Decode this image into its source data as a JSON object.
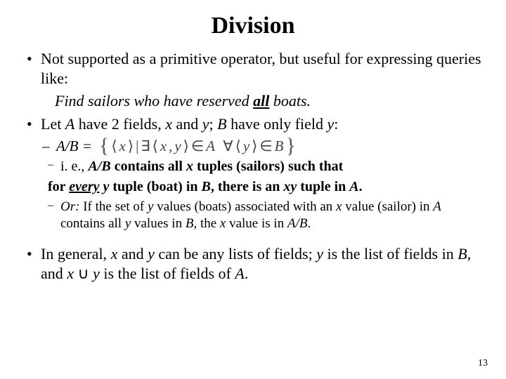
{
  "title": "Division",
  "bullets": {
    "b1a": "Not supported as a primitive operator, but useful for expressing queries like:",
    "example_pre": "Find sailors who have reserved ",
    "example_all": "all",
    "example_post": " boats.",
    "b2_pre": "Let ",
    "b2_A": "A",
    "b2_mid1": " have 2 fields, ",
    "b2_x": "x",
    "b2_and": " and ",
    "b2_y": "y",
    "b2_mid2": "; ",
    "b2_B": "B",
    "b2_mid3": " have only field ",
    "b2_y2": "y",
    "b2_end": ":",
    "sub1_lhs": "A/B =",
    "subsub1_pre": "i. e., ",
    "subsub1_ab": "A/B",
    "subsub1_mid1": " contains all ",
    "subsub1_x": "x",
    "subsub1_mid2": " tuples (sailors) such that",
    "subsub1_line2_pre": "for ",
    "subsub1_every": "every",
    "subsub1_sp": " ",
    "subsub1_y": "y",
    "subsub1_mid3": " tuple (boat) in ",
    "subsub1_B": "B",
    "subsub1_mid4": ", there is an ",
    "subsub1_xy": "xy",
    "subsub1_mid5": " tuple in ",
    "subsub1_A": "A",
    "subsub1_end": ".",
    "subsub2_or": "Or:",
    "subsub2_mid1": " If the set of ",
    "subsub2_y": "y",
    "subsub2_mid2": " values (boats) associated with an ",
    "subsub2_x": "x",
    "subsub2_mid3": " value (sailor) in ",
    "subsub2_A": "A",
    "subsub2_mid4": " contains all ",
    "subsub2_y2": "y",
    "subsub2_mid5": " values in ",
    "subsub2_B": "B",
    "subsub2_mid6": ", the ",
    "subsub2_x2": "x",
    "subsub2_mid7": " value is in ",
    "subsub2_AB": "A/B",
    "subsub2_end": ".",
    "b3_pre": "In general, ",
    "b3_x": "x",
    "b3_and": " and ",
    "b3_y": "y",
    "b3_mid1": " can be any lists of fields; ",
    "b3_y2": "y",
    "b3_mid2": " is the list of fields in ",
    "b3_B": "B",
    "b3_mid3": ", and ",
    "b3_x2": "x",
    "b3_union": " ∪ ",
    "b3_y3": "y",
    "b3_mid4": " is the list of fields of ",
    "b3_A": "A",
    "b3_end": "."
  },
  "formula": {
    "lb": "{",
    "langle": "⟨",
    "x": "x",
    "rangle": "⟩",
    "bar": "|",
    "exists": "∃",
    "comma": ",",
    "y": "y",
    "in": "∈",
    "A": "A",
    "forall": "∀",
    "B": "B",
    "rb": "}"
  },
  "page_number": "13"
}
